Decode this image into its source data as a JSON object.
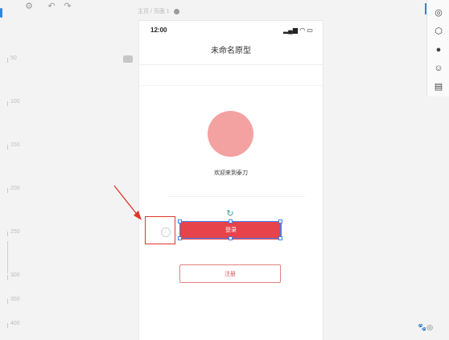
{
  "toolbar": {
    "icons": [
      "gear-icon",
      "undo-icon",
      "redo-icon"
    ],
    "breadcrumb": "主页 / 页面 1"
  },
  "ruler": {
    "labels": [
      "50",
      "100",
      "150",
      "200",
      "250",
      "300",
      "350",
      "400"
    ]
  },
  "phone": {
    "time": "12:00",
    "status_icons": "▂▄▆ ◠ ▭",
    "title": "未命名原型",
    "welcome_text": "欢迎来到泰刀",
    "login_label": "登录",
    "register_label": "注册"
  },
  "right_panel": {
    "icons": [
      "target-icon",
      "cube-icon",
      "user-icon",
      "emoji-icon",
      "table-icon"
    ]
  },
  "colors": {
    "accent": "#2e86de",
    "primary_red": "#e6434b",
    "avatar": "#f4a1a2",
    "annotation": "#e0362c"
  }
}
